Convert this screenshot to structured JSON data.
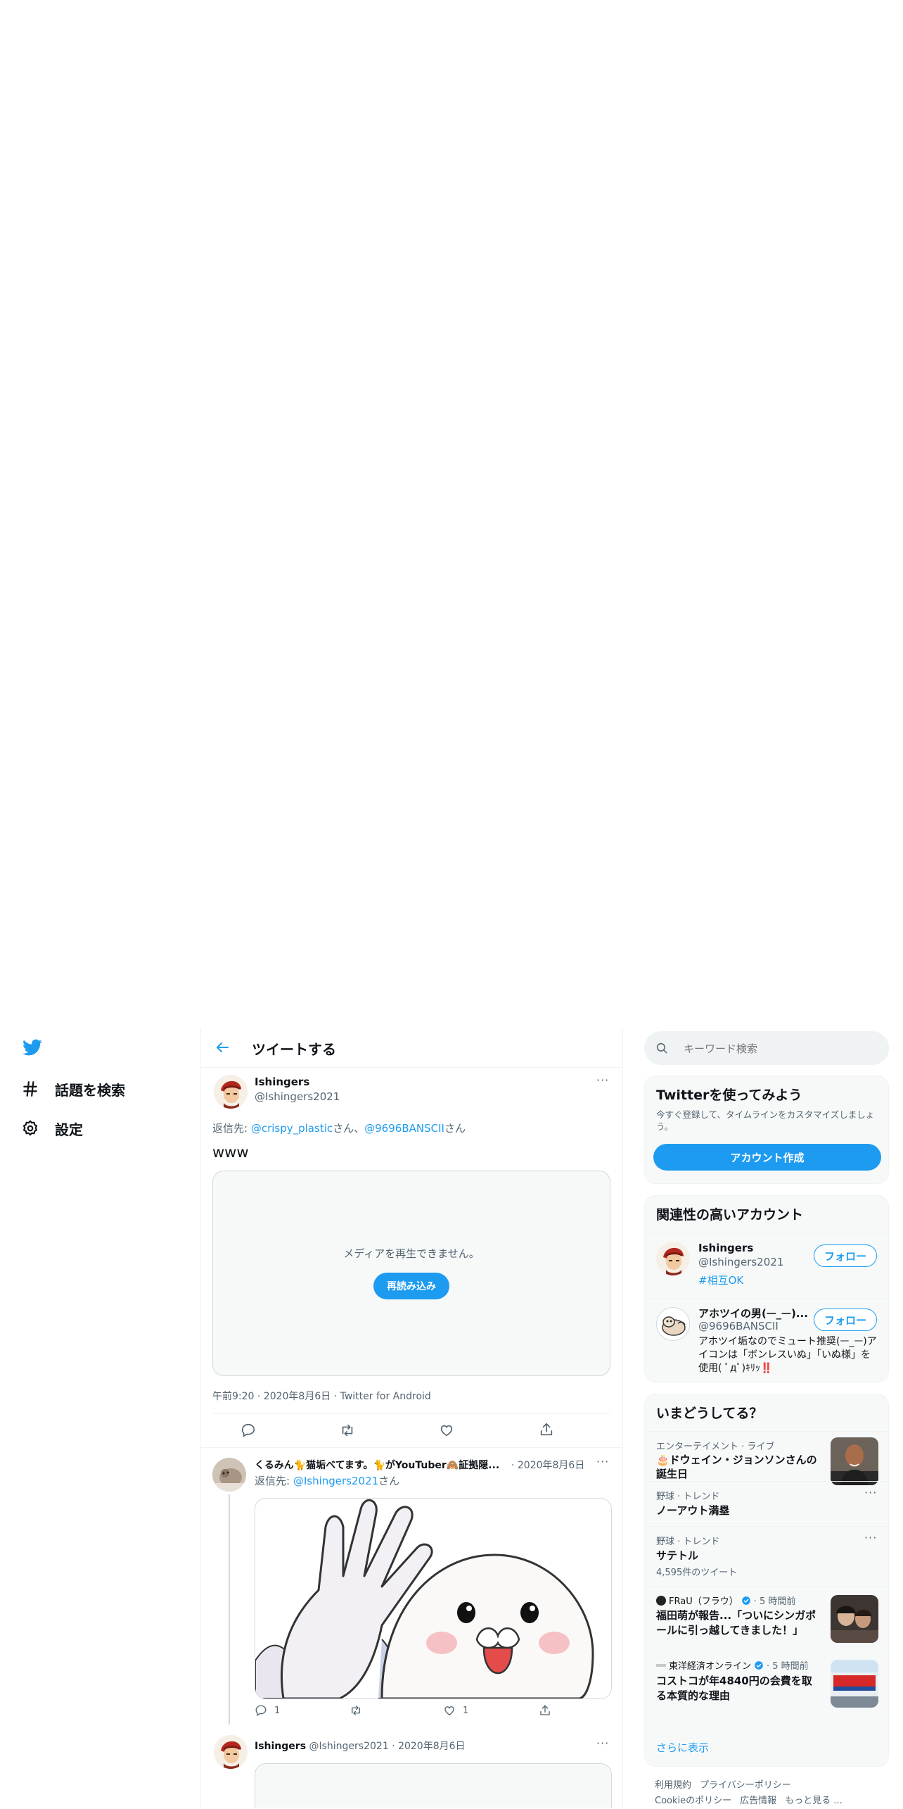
{
  "nav": {
    "logo": "twitter-bird-icon",
    "explore_label": "話題を検索",
    "settings_label": "設定"
  },
  "header": {
    "title": "ツイートする"
  },
  "main_tweet": {
    "name": "Ishingers",
    "handle": "@Ishingers2021",
    "reply_prefix": "返信先: ",
    "reply_user1": "@crispy_plastic",
    "reply_sep": "さん、",
    "reply_user2": "@9696BANSCII",
    "reply_suffix": "さん",
    "text": "www",
    "media_error": "メディアを再生できません。",
    "reload_label": "再読み込み",
    "meta": "午前9:20 · 2020年8月6日 · Twitter for Android"
  },
  "reply1": {
    "name": "くるみん🐈猫垢べてます。🐈がYouTuber🙈証拠隠...",
    "date": "· 2020年8月6日",
    "reply_prefix": "返信先: ",
    "reply_user": "@Ishingers2021",
    "reply_suffix": "さん",
    "reply_count": "1",
    "like_count": "1"
  },
  "reply2": {
    "name": "Ishingers",
    "handle": "@Ishingers2021",
    "date": "· 2020年8月6日"
  },
  "search": {
    "placeholder": "キーワード検索"
  },
  "signup_card": {
    "title": "Twitterを使ってみよう",
    "desc": "今すぐ登録して、タイムラインをカスタマイズしましょう。",
    "button": "アカウント作成"
  },
  "related": {
    "title": "関連性の高いアカウント",
    "accounts": [
      {
        "name": "Ishingers",
        "handle": "@Ishingers2021",
        "bio": "#相互OK",
        "follow": "フォロー"
      },
      {
        "name": "アホツイの男(ᅳ_ᅳ)...",
        "handle": "@9696BANSCII",
        "bio": "アホツイ垢なのでミュート推奨(ᅳ_ᅳ)アイコンは「ボンレスいぬ」「いぬ様」を使用( ﾟдﾟ)ｷﾘｯ‼️",
        "follow": "フォロー"
      }
    ]
  },
  "trends": {
    "title": "いまどうしてる？",
    "items": [
      {
        "context": "エンターテイメント · ライブ",
        "topic": "🎂ドウェイン・ジョンソンさんの誕生日"
      },
      {
        "context": "野球 · トレンド",
        "topic": "ノーアウト満塁"
      },
      {
        "context": "野球 · トレンド",
        "topic": "サテトル",
        "count": "4,595件のツイート"
      },
      {
        "context_source": "FRaU（フラウ）",
        "context_time": "· 5 時間前",
        "topic": "福田萌が報告...「ついにシンガポールに引っ越してきました！」"
      },
      {
        "context_source": "東洋経済オンライン",
        "context_time": "· 5 時間前",
        "topic": "コストコが年4840円の会費を取る本質的な理由"
      }
    ],
    "show_more": "さらに表示"
  },
  "footer": {
    "links_row1": [
      "利用規約",
      "プライバシーポリシー"
    ],
    "links_row2": [
      "Cookieのポリシー",
      "広告情報",
      "もっと見る ..."
    ]
  },
  "colors": {
    "accent": "#1d9bf0",
    "text": "#0f1419",
    "secondary": "#536471",
    "border": "#eff3f4"
  }
}
